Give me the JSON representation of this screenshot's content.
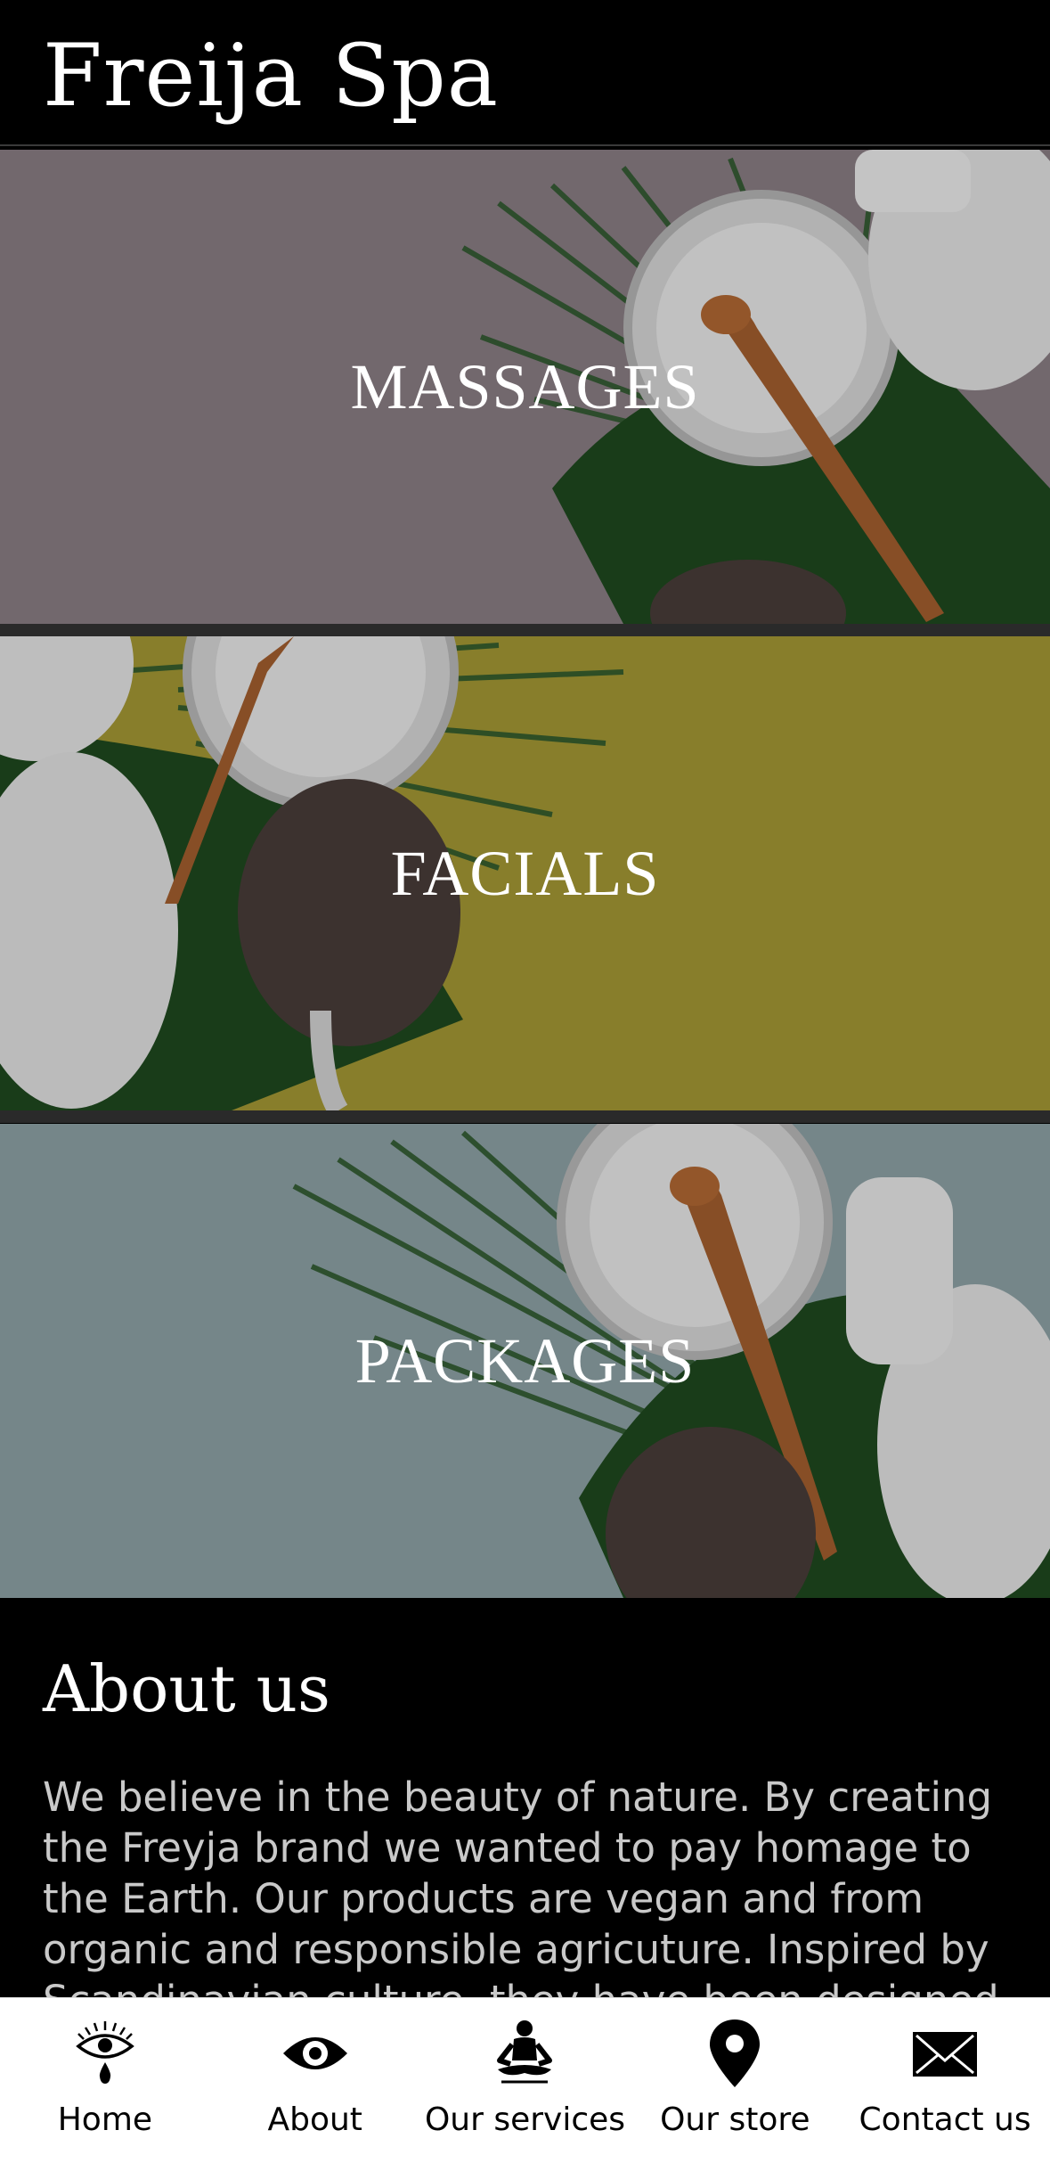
{
  "header": {
    "title": "Freija Spa"
  },
  "cards": [
    {
      "label": "MASSAGES"
    },
    {
      "label": "FACIALS"
    },
    {
      "label": "PACKAGES"
    }
  ],
  "about": {
    "heading": "About us",
    "body": "We believe in the beauty of nature. By creating the Freyja brand we wanted to pay homage to the Earth. Our products are vegan and from organic and responsible agricuture. Inspired by Scandinavian culture, they have been designed to give you the"
  },
  "tabbar": {
    "items": [
      {
        "label": "Home",
        "icon": "eye-tear-icon"
      },
      {
        "label": "About",
        "icon": "eye-icon"
      },
      {
        "label": "Our services",
        "icon": "meditation-icon"
      },
      {
        "label": "Our store",
        "icon": "map-pin-icon"
      },
      {
        "label": "Contact us",
        "icon": "envelope-icon"
      }
    ]
  },
  "colors": {
    "massages_bg": "#8c7f86",
    "facials_bg": "#a69a35",
    "packages_bg": "#8fa4a8",
    "leaf": "#1f4a1f"
  }
}
